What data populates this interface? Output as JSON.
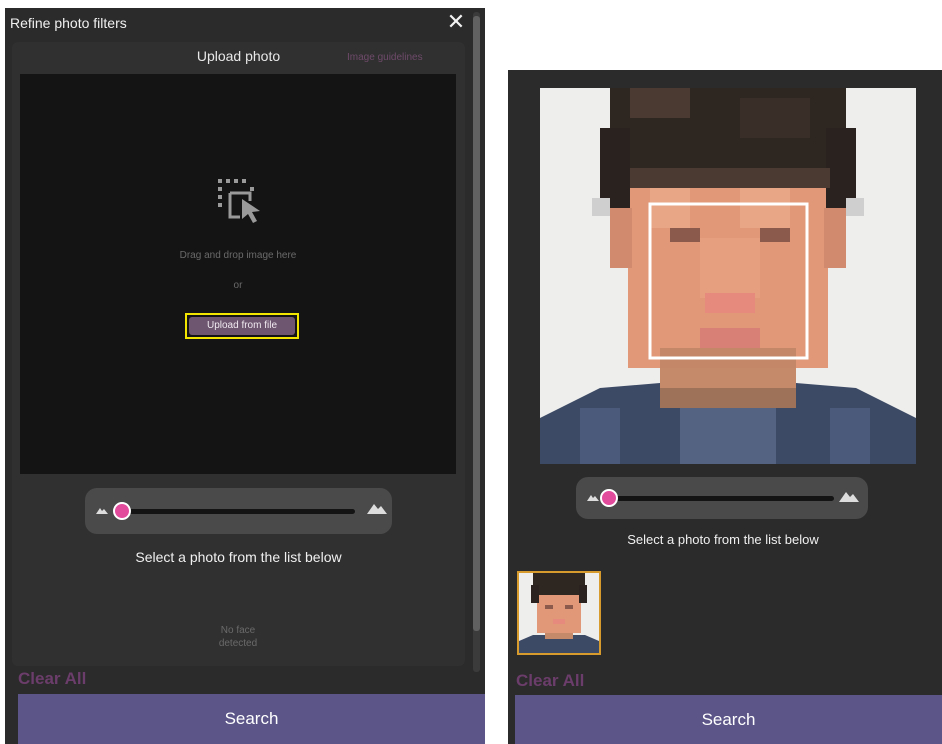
{
  "left": {
    "title": "Refine photo filters",
    "close_label": "✕",
    "upload_heading": "Upload photo",
    "guidelines_link": "Image guidelines",
    "drop_text": "Drag and drop image here",
    "or_text": "or",
    "upload_button": "Upload from file",
    "slider_level": 0,
    "select_label": "Select a photo from the list below",
    "no_face_line1": "No face",
    "no_face_line2": "detected",
    "clear_all": "Clear All",
    "search": "Search"
  },
  "right": {
    "slider_level": 0,
    "select_label": "Select a photo from the list below",
    "clear_all": "Clear All",
    "search": "Search"
  },
  "colors": {
    "panel_bg": "#2b2b2b",
    "accent_pink": "#e24a9c",
    "upload_button_bg": "#6e5570",
    "highlight_yellow": "#f2e600",
    "search_bg": "#5b5588",
    "clear_all": "#6b3d6a",
    "thumb_border": "#d79a2c",
    "face_box": "#ffffff"
  },
  "icons": [
    "close-icon",
    "drag-drop-select-icon",
    "small-mountain-icon",
    "large-mountain-icon"
  ]
}
